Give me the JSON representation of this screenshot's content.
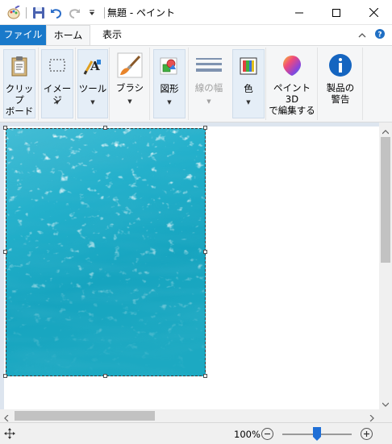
{
  "window": {
    "title": "無題 - ペイント"
  },
  "tabs": [
    {
      "label": "ファイル"
    },
    {
      "label": "ホーム"
    },
    {
      "label": "表示"
    }
  ],
  "ribbon": {
    "clipboard": {
      "label": "クリップ\nボード",
      "arrow": "▼"
    },
    "image": {
      "label": "イメージ",
      "arrow": "▼"
    },
    "tools": {
      "label": "ツール",
      "arrow": "▼"
    },
    "brushes": {
      "label": "ブラシ",
      "arrow": "▼"
    },
    "shapes": {
      "label": "図形",
      "arrow": "▼"
    },
    "line_width": {
      "label": "線の幅",
      "arrow": "▼"
    },
    "colors": {
      "label": "色",
      "arrow": "▼"
    },
    "paint3d": {
      "label": "ペイント 3D\nで編集する"
    },
    "product_alert": {
      "label": "製品の\n警告"
    }
  },
  "status": {
    "zoom_text": "100%",
    "zoom_level": 1.0
  },
  "colors": {
    "accent": "#1979ca",
    "ribbon_bg": "#f5f6f7",
    "canvas_bg": "#dde5ef",
    "water": "#1aa7c0"
  }
}
